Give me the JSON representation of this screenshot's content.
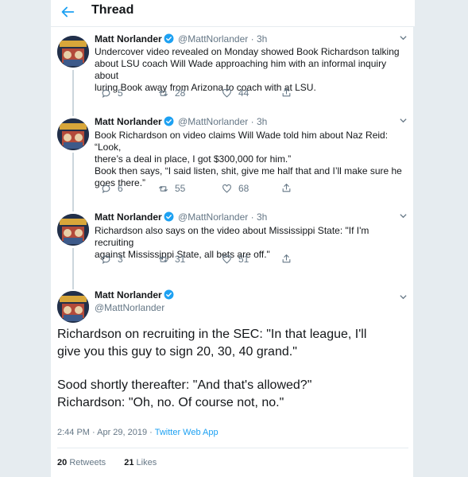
{
  "header": {
    "title": "Thread",
    "back_icon": "arrow-left-icon"
  },
  "colors": {
    "accent": "#1da1f2",
    "muted": "#657786",
    "text": "#14171a",
    "background": "#e6ecf0"
  },
  "tweets": [
    {
      "author": "Matt Norlander",
      "handle": "@MattNorlander",
      "separator": "·",
      "time": "3h",
      "lines": [
        "Undercover video revealed on Monday showed Book Richardson talking",
        "about LSU coach Will Wade approaching him with an informal inquiry about",
        "luring Book away from Arizona to coach with at LSU."
      ],
      "replies": "5",
      "retweets": "28",
      "likes": "44"
    },
    {
      "author": "Matt Norlander",
      "handle": "@MattNorlander",
      "separator": "·",
      "time": "3h",
      "lines": [
        "Book Richardson on video claims Will Wade told him about Naz Reid: “Look,",
        "there’s a deal in place, I got $300,000 for him.”",
        "Book then says, “I said listen, shit, give me half that and I’ll make sure he",
        "goes there.”"
      ],
      "replies": "6",
      "retweets": "55",
      "likes": "68"
    },
    {
      "author": "Matt Norlander",
      "handle": "@MattNorlander",
      "separator": "·",
      "time": "3h",
      "lines": [
        "Richardson also says on the video about Mississippi State: \"If I'm recruiting",
        "against Mississippi State, all bets are off.\""
      ],
      "replies": "3",
      "retweets": "31",
      "likes": "51"
    }
  ],
  "main_tweet": {
    "author": "Matt Norlander",
    "handle": "@MattNorlander",
    "lines": [
      "Richardson on recruiting in the SEC: \"In that league, I'll",
      "give you this guy to sign 20, 30, 40 grand.\""
    ],
    "lines2": [
      "Sood shortly thereafter: \"And that's allowed?\"",
      "Richardson: \"Oh, no. Of course not, no.\""
    ],
    "time": "2:44 PM · Apr 29, 2019 ·",
    "source": "Twitter Web App",
    "retweets_count": "20",
    "retweets_label": "Retweets",
    "likes_count": "21",
    "likes_label": "Likes"
  }
}
